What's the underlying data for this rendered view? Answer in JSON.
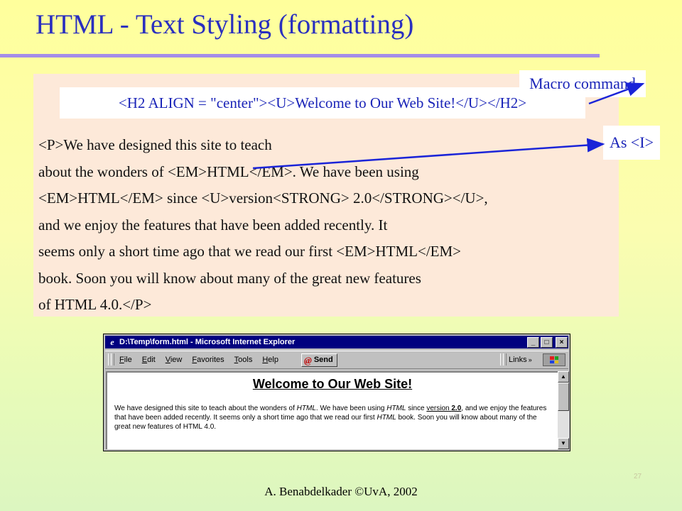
{
  "slide": {
    "title": "HTML - Text Styling (formatting)",
    "footer": "A. Benabdelkader ©UvA, 2002",
    "page_number": "27"
  },
  "code": {
    "h2_line": "<H2 ALIGN = \"center\"><U>Welcome to Our Web Site!</U></H2>",
    "lines": [
      "<P>We have designed this site to teach",
      "about the wonders of <EM>HTML</EM>. We have been using",
      "<EM>HTML</EM> since <U>version<STRONG> 2.0</STRONG></U>,",
      "and we enjoy the features that have been added recently. It",
      "seems only a short time ago that we read our first <EM>HTML</EM>",
      "book. Soon you will know about many of the great new features",
      "of HTML 4.0.</P>"
    ]
  },
  "annotations": {
    "macro_label": "Macro command",
    "as_label": "As <I>",
    "arrow_color": "#1a24d8"
  },
  "browser": {
    "title": "D:\\Temp\\form.html - Microsoft Internet Explorer",
    "icon": "e",
    "window_buttons": {
      "minimize": "_",
      "maximize": "□",
      "close": "×"
    },
    "menu": [
      {
        "label": "File",
        "ul": "F",
        "rest": "ile"
      },
      {
        "label": "Edit",
        "ul": "E",
        "rest": "dit"
      },
      {
        "label": "View",
        "ul": "V",
        "rest": "iew"
      },
      {
        "label": "Favorites",
        "ul": "F",
        "rest": "avorites"
      },
      {
        "label": "Tools",
        "ul": "T",
        "rest": "ools"
      },
      {
        "label": "Help",
        "ul": "H",
        "rest": "elp"
      }
    ],
    "send_label": "Send",
    "send_icon": "@",
    "links_label": "Links",
    "links_arrow": "»",
    "page_heading": "Welcome to Our Web Site!",
    "paragraph": {
      "t1": "We have designed this site to teach about the wonders of ",
      "em1": "HTML",
      "t2": ". We have been using ",
      "em2": "HTML",
      "t3": " since ",
      "u1": "version ",
      "strong1": "2.0",
      "t4": ", and we enjoy the features that have been added recently. It seems only a short time ago that we read our first ",
      "em3": "HTML",
      "t5": " book. Soon you will know about many of the great new features of HTML 4.0."
    },
    "scroll_up": "▲",
    "scroll_down": "▼"
  }
}
